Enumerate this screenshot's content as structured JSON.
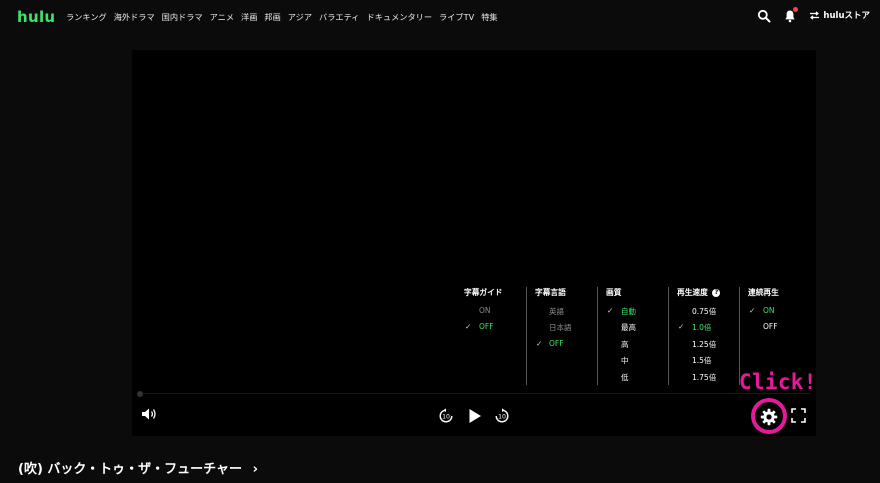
{
  "header": {
    "logo": "hulu",
    "nav": [
      "ランキング",
      "海外ドラマ",
      "国内ドラマ",
      "アニメ",
      "洋画",
      "邦画",
      "アジア",
      "バラエティ",
      "ドキュメンタリー",
      "ライブTV",
      "特集"
    ],
    "store_label": "huluストア"
  },
  "settings": {
    "subtitle_guide": {
      "title": "字幕ガイド",
      "options": [
        "ON",
        "OFF"
      ],
      "selected": "OFF"
    },
    "subtitle_language": {
      "title": "字幕言語",
      "options": [
        "英語",
        "日本語",
        "OFF"
      ],
      "selected": "OFF"
    },
    "quality": {
      "title": "画質",
      "options": [
        "自動",
        "最高",
        "高",
        "中",
        "低"
      ],
      "selected": "自動"
    },
    "playback_speed": {
      "title": "再生速度",
      "help_icon": "?",
      "options": [
        "0.75倍",
        "1.0倍",
        "1.25倍",
        "1.5倍",
        "1.75倍"
      ],
      "selected": "1.0倍"
    },
    "autoplay": {
      "title": "連続再生",
      "options": [
        "ON",
        "OFF"
      ],
      "selected": "ON"
    }
  },
  "controls": {
    "rewind_seconds": "10",
    "forward_seconds": "10"
  },
  "annotation": {
    "text": "Click!",
    "color": "#e6199a"
  },
  "title": "(吹) バック・トゥ・ザ・フューチャー",
  "title_chevron": "›",
  "colors": {
    "accent": "#3ee36b",
    "annotation": "#e6199a",
    "background": "#0b0b0b",
    "player": "#000000"
  }
}
